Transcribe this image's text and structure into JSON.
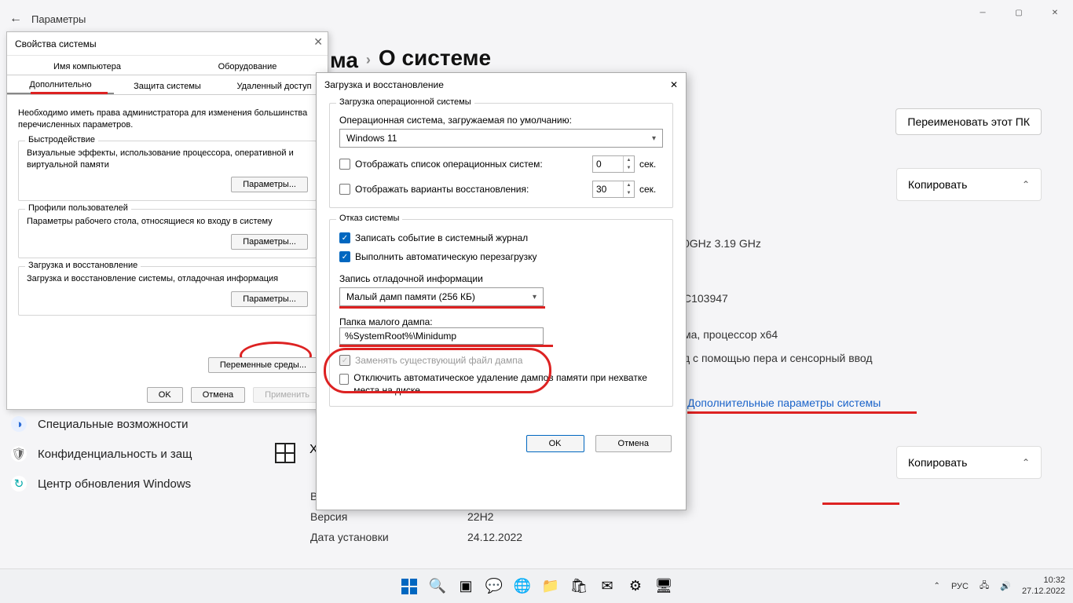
{
  "settings": {
    "back_icon": "←",
    "title": "Параметры",
    "breadcrumb_part": "ма",
    "breadcrumb_sep": "›",
    "breadcrumb_current": "О системе",
    "rename_btn": "Переименовать этот ПК",
    "copy_btn": "Копировать",
    "spec_cpu": "0GHz   3.19 GHz",
    "spec_code": "C103947",
    "spec_arch": "ма, процессор x64",
    "spec_pen": "д с помощью пера и сенсорный ввод",
    "adv_link": "Дополнительные параметры системы",
    "winspec_label": "Характеристики Windows",
    "row_edition_k": "Выпуск",
    "row_edition_v": "",
    "row_version_k": "Версия",
    "row_version_v": "22H2",
    "row_install_k": "Дата установки",
    "row_install_v": "24.12.2022"
  },
  "sidebar": {
    "items": [
      {
        "label": "Специальные возможности"
      },
      {
        "label": "Конфиденциальность и защ"
      },
      {
        "label": "Центр обновления Windows"
      }
    ]
  },
  "sysprops": {
    "title": "Свойства системы",
    "tabs_top": [
      "Имя компьютера",
      "Оборудование"
    ],
    "tabs_bot": [
      "Дополнительно",
      "Защита системы",
      "Удаленный доступ"
    ],
    "note": "Необходимо иметь права администратора для изменения большинства перечисленных параметров.",
    "perf": {
      "label": "Быстродействие",
      "text": "Визуальные эффекты, использование процессора, оперативной и виртуальной памяти",
      "btn": "Параметры..."
    },
    "prof": {
      "label": "Профили пользователей",
      "text": "Параметры рабочего стола, относящиеся ко входу в систему",
      "btn": "Параметры..."
    },
    "startup": {
      "label": "Загрузка и восстановление",
      "text": "Загрузка и восстановление системы, отладочная информация",
      "btn": "Параметры..."
    },
    "env_btn": "Переменные среды...",
    "ok": "OK",
    "cancel": "Отмена",
    "apply": "Применить"
  },
  "su": {
    "title": "Загрузка и восстановление",
    "boot": {
      "label": "Загрузка операционной системы",
      "default_label": "Операционная система, загружаемая по умолчанию:",
      "os": "Windows 11",
      "show_list": "Отображать список операционных систем:",
      "show_list_sec": "0",
      "show_recov": "Отображать варианты восстановления:",
      "show_recov_sec": "30",
      "sec": "сек."
    },
    "fail": {
      "label": "Отказ системы",
      "evt": "Записать событие в системный журнал",
      "auto": "Выполнить автоматическую перезагрузку",
      "dbg_label": "Запись отладочной информации",
      "dump_type": "Малый дамп памяти (256 КБ)",
      "dumpdir_label": "Папка малого дампа:",
      "dumpdir": "%SystemRoot%\\Minidump",
      "overwrite": "Заменять существующий файл дампа",
      "autodel": "Отключить автоматическое удаление дампов памяти при нехватке места на диске"
    },
    "ok": "OK",
    "cancel": "Отмена"
  },
  "taskbar": {
    "lang": "РУС",
    "time": "10:32",
    "date": "27.12.2022"
  }
}
